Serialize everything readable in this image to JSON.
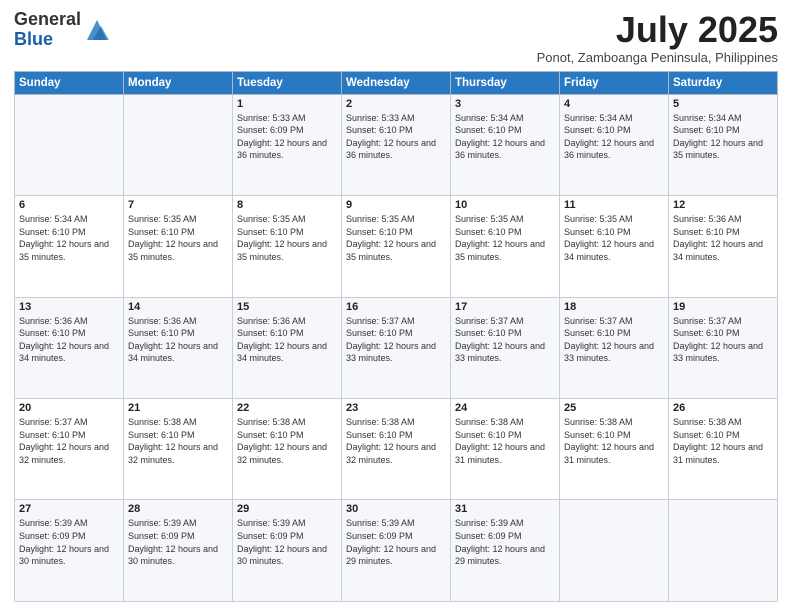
{
  "logo": {
    "general": "General",
    "blue": "Blue"
  },
  "title": "July 2025",
  "location": "Ponot, Zamboanga Peninsula, Philippines",
  "days_of_week": [
    "Sunday",
    "Monday",
    "Tuesday",
    "Wednesday",
    "Thursday",
    "Friday",
    "Saturday"
  ],
  "weeks": [
    [
      {
        "day": "",
        "info": ""
      },
      {
        "day": "",
        "info": ""
      },
      {
        "day": "1",
        "info": "Sunrise: 5:33 AM\nSunset: 6:09 PM\nDaylight: 12 hours and 36 minutes."
      },
      {
        "day": "2",
        "info": "Sunrise: 5:33 AM\nSunset: 6:10 PM\nDaylight: 12 hours and 36 minutes."
      },
      {
        "day": "3",
        "info": "Sunrise: 5:34 AM\nSunset: 6:10 PM\nDaylight: 12 hours and 36 minutes."
      },
      {
        "day": "4",
        "info": "Sunrise: 5:34 AM\nSunset: 6:10 PM\nDaylight: 12 hours and 36 minutes."
      },
      {
        "day": "5",
        "info": "Sunrise: 5:34 AM\nSunset: 6:10 PM\nDaylight: 12 hours and 35 minutes."
      }
    ],
    [
      {
        "day": "6",
        "info": "Sunrise: 5:34 AM\nSunset: 6:10 PM\nDaylight: 12 hours and 35 minutes."
      },
      {
        "day": "7",
        "info": "Sunrise: 5:35 AM\nSunset: 6:10 PM\nDaylight: 12 hours and 35 minutes."
      },
      {
        "day": "8",
        "info": "Sunrise: 5:35 AM\nSunset: 6:10 PM\nDaylight: 12 hours and 35 minutes."
      },
      {
        "day": "9",
        "info": "Sunrise: 5:35 AM\nSunset: 6:10 PM\nDaylight: 12 hours and 35 minutes."
      },
      {
        "day": "10",
        "info": "Sunrise: 5:35 AM\nSunset: 6:10 PM\nDaylight: 12 hours and 35 minutes."
      },
      {
        "day": "11",
        "info": "Sunrise: 5:35 AM\nSunset: 6:10 PM\nDaylight: 12 hours and 34 minutes."
      },
      {
        "day": "12",
        "info": "Sunrise: 5:36 AM\nSunset: 6:10 PM\nDaylight: 12 hours and 34 minutes."
      }
    ],
    [
      {
        "day": "13",
        "info": "Sunrise: 5:36 AM\nSunset: 6:10 PM\nDaylight: 12 hours and 34 minutes."
      },
      {
        "day": "14",
        "info": "Sunrise: 5:36 AM\nSunset: 6:10 PM\nDaylight: 12 hours and 34 minutes."
      },
      {
        "day": "15",
        "info": "Sunrise: 5:36 AM\nSunset: 6:10 PM\nDaylight: 12 hours and 34 minutes."
      },
      {
        "day": "16",
        "info": "Sunrise: 5:37 AM\nSunset: 6:10 PM\nDaylight: 12 hours and 33 minutes."
      },
      {
        "day": "17",
        "info": "Sunrise: 5:37 AM\nSunset: 6:10 PM\nDaylight: 12 hours and 33 minutes."
      },
      {
        "day": "18",
        "info": "Sunrise: 5:37 AM\nSunset: 6:10 PM\nDaylight: 12 hours and 33 minutes."
      },
      {
        "day": "19",
        "info": "Sunrise: 5:37 AM\nSunset: 6:10 PM\nDaylight: 12 hours and 33 minutes."
      }
    ],
    [
      {
        "day": "20",
        "info": "Sunrise: 5:37 AM\nSunset: 6:10 PM\nDaylight: 12 hours and 32 minutes."
      },
      {
        "day": "21",
        "info": "Sunrise: 5:38 AM\nSunset: 6:10 PM\nDaylight: 12 hours and 32 minutes."
      },
      {
        "day": "22",
        "info": "Sunrise: 5:38 AM\nSunset: 6:10 PM\nDaylight: 12 hours and 32 minutes."
      },
      {
        "day": "23",
        "info": "Sunrise: 5:38 AM\nSunset: 6:10 PM\nDaylight: 12 hours and 32 minutes."
      },
      {
        "day": "24",
        "info": "Sunrise: 5:38 AM\nSunset: 6:10 PM\nDaylight: 12 hours and 31 minutes."
      },
      {
        "day": "25",
        "info": "Sunrise: 5:38 AM\nSunset: 6:10 PM\nDaylight: 12 hours and 31 minutes."
      },
      {
        "day": "26",
        "info": "Sunrise: 5:38 AM\nSunset: 6:10 PM\nDaylight: 12 hours and 31 minutes."
      }
    ],
    [
      {
        "day": "27",
        "info": "Sunrise: 5:39 AM\nSunset: 6:09 PM\nDaylight: 12 hours and 30 minutes."
      },
      {
        "day": "28",
        "info": "Sunrise: 5:39 AM\nSunset: 6:09 PM\nDaylight: 12 hours and 30 minutes."
      },
      {
        "day": "29",
        "info": "Sunrise: 5:39 AM\nSunset: 6:09 PM\nDaylight: 12 hours and 30 minutes."
      },
      {
        "day": "30",
        "info": "Sunrise: 5:39 AM\nSunset: 6:09 PM\nDaylight: 12 hours and 29 minutes."
      },
      {
        "day": "31",
        "info": "Sunrise: 5:39 AM\nSunset: 6:09 PM\nDaylight: 12 hours and 29 minutes."
      },
      {
        "day": "",
        "info": ""
      },
      {
        "day": "",
        "info": ""
      }
    ]
  ]
}
